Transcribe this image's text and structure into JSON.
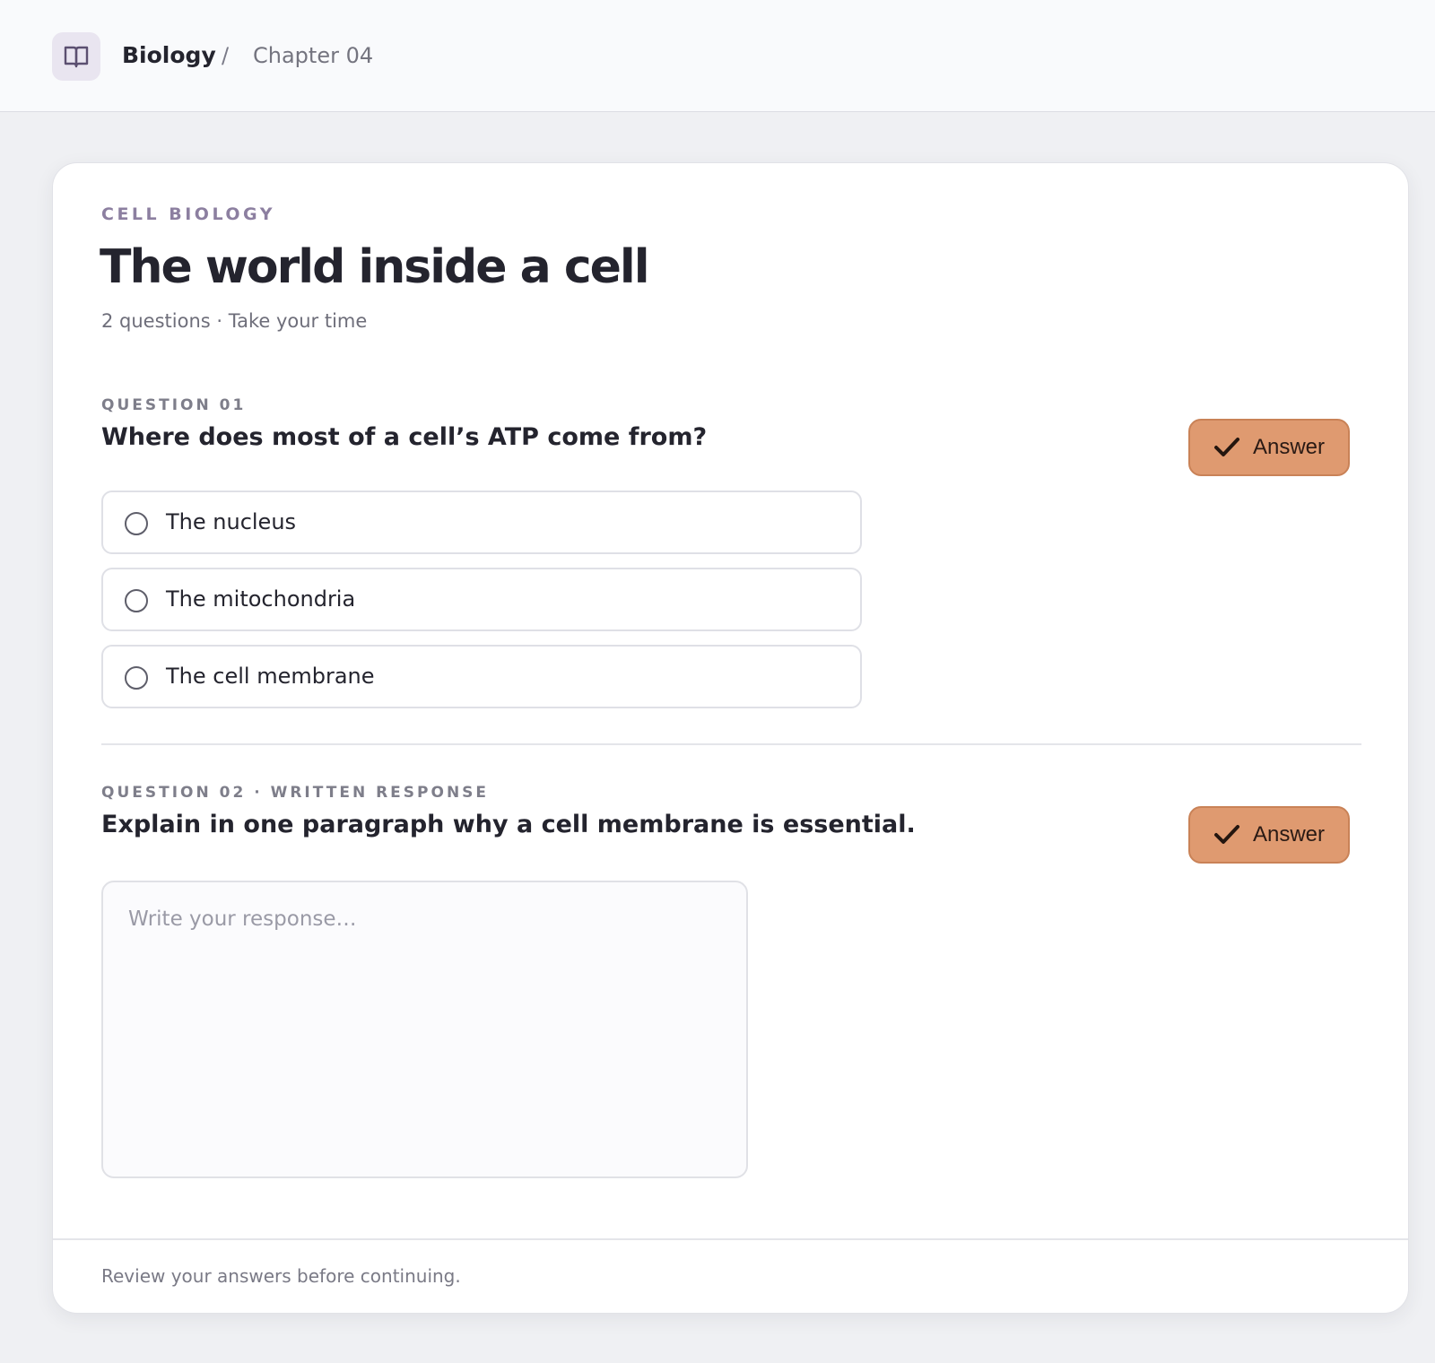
{
  "header": {
    "icon": "book-open-icon",
    "breadcrumb_root": "Biology",
    "breadcrumb_separator": "/",
    "breadcrumb_current": "Chapter 04"
  },
  "quiz": {
    "eyebrow": "CELL BIOLOGY",
    "title": "The world inside a cell",
    "subtitle": "2 questions · Take your time",
    "accent_color": "#df9a70",
    "questions": [
      {
        "label": "QUESTION 01",
        "prompt": "Where does most of a cell’s ATP come from?",
        "answer_label": "Answer",
        "options": [
          "The nucleus",
          "The mitochondria",
          "The cell membrane"
        ]
      },
      {
        "label": "QUESTION 02 · WRITTEN RESPONSE",
        "prompt": "Explain in one paragraph why a cell membrane is essential.",
        "answer_label": "Answer",
        "response_value": "",
        "response_placeholder": "Write your response…"
      }
    ],
    "footer_note": "Review your answers before continuing."
  }
}
